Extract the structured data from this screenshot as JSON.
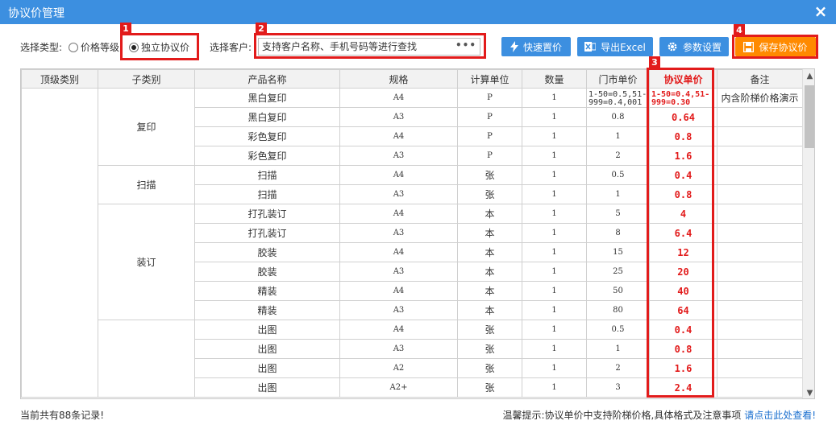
{
  "window": {
    "title": "协议价管理",
    "close_icon": "×"
  },
  "toolbar": {
    "type_label": "选择类型:",
    "radio_tier": "价格等级",
    "radio_independent": "独立协议价",
    "customer_label": "选择客户:",
    "customer_placeholder": "支持客户名称、手机号码等进行查找",
    "more_icon": "•••",
    "quick_price": "快速置价",
    "export_excel": "导出Excel",
    "settings": "参数设置",
    "save": "保存协议价"
  },
  "badges": {
    "b1": "1",
    "b2": "2",
    "b3": "3",
    "b4": "4"
  },
  "table": {
    "headers": [
      "顶级类别",
      "子类别",
      "产品名称",
      "规格",
      "计算单位",
      "数量",
      "门市单价",
      "协议单价",
      "备注"
    ],
    "groups": [
      {
        "name": "复印"
      },
      {
        "name": "扫描"
      },
      {
        "name": "装订"
      },
      {
        "name": ""
      }
    ],
    "rows": [
      {
        "product": "黑白复印",
        "spec": "A4",
        "unit": "P",
        "qty": "1",
        "retail": "1-50=0.5,51-999=0.4,001",
        "agreement": "1-50=0.4,51-999=0.30",
        "note": "内含阶梯价格演示"
      },
      {
        "product": "黑白复印",
        "spec": "A3",
        "unit": "P",
        "qty": "1",
        "retail": "0.8",
        "agreement": "0.64",
        "note": ""
      },
      {
        "product": "彩色复印",
        "spec": "A4",
        "unit": "P",
        "qty": "1",
        "retail": "1",
        "agreement": "0.8",
        "note": ""
      },
      {
        "product": "彩色复印",
        "spec": "A3",
        "unit": "P",
        "qty": "1",
        "retail": "2",
        "agreement": "1.6",
        "note": ""
      },
      {
        "product": "扫描",
        "spec": "A4",
        "unit": "张",
        "qty": "1",
        "retail": "0.5",
        "agreement": "0.4",
        "note": ""
      },
      {
        "product": "扫描",
        "spec": "A3",
        "unit": "张",
        "qty": "1",
        "retail": "1",
        "agreement": "0.8",
        "note": ""
      },
      {
        "product": "打孔装订",
        "spec": "A4",
        "unit": "本",
        "qty": "1",
        "retail": "5",
        "agreement": "4",
        "note": ""
      },
      {
        "product": "打孔装订",
        "spec": "A3",
        "unit": "本",
        "qty": "1",
        "retail": "8",
        "agreement": "6.4",
        "note": ""
      },
      {
        "product": "胶装",
        "spec": "A4",
        "unit": "本",
        "qty": "1",
        "retail": "15",
        "agreement": "12",
        "note": ""
      },
      {
        "product": "胶装",
        "spec": "A3",
        "unit": "本",
        "qty": "1",
        "retail": "25",
        "agreement": "20",
        "note": ""
      },
      {
        "product": "精装",
        "spec": "A4",
        "unit": "本",
        "qty": "1",
        "retail": "50",
        "agreement": "40",
        "note": ""
      },
      {
        "product": "精装",
        "spec": "A3",
        "unit": "本",
        "qty": "1",
        "retail": "80",
        "agreement": "64",
        "note": ""
      },
      {
        "product": "出图",
        "spec": "A4",
        "unit": "张",
        "qty": "1",
        "retail": "0.5",
        "agreement": "0.4",
        "note": ""
      },
      {
        "product": "出图",
        "spec": "A3",
        "unit": "张",
        "qty": "1",
        "retail": "1",
        "agreement": "0.8",
        "note": ""
      },
      {
        "product": "出图",
        "spec": "A2",
        "unit": "张",
        "qty": "1",
        "retail": "2",
        "agreement": "1.6",
        "note": ""
      },
      {
        "product": "出图",
        "spec": "A2+",
        "unit": "张",
        "qty": "1",
        "retail": "3",
        "agreement": "2.4",
        "note": ""
      }
    ]
  },
  "footer": {
    "record_count": "当前共有88条记录!",
    "tip": "温馨提示:协议单价中支持阶梯价格,具体格式及注意事项",
    "tip_link": "请点击此处查看!"
  },
  "colors": {
    "accent": "#3c8fe0",
    "save": "#ff8a00",
    "highlight": "#e21b1b"
  }
}
